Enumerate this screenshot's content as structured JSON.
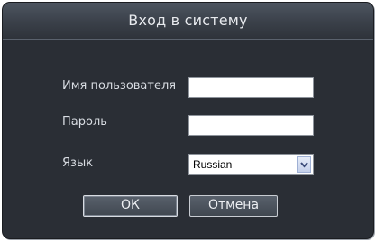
{
  "dialog": {
    "title": "Вход в систему"
  },
  "form": {
    "username_label": "Имя пользователя",
    "username_value": "",
    "password_label": "Пароль",
    "password_value": "",
    "language_label": "Язык",
    "language_selected": "Russian"
  },
  "buttons": {
    "ok_label": "ОК",
    "cancel_label": "Отмена"
  },
  "icons": {
    "dropdown": "chevron-down-icon"
  },
  "colors": {
    "background": "#2a2e35",
    "title_bar": "#3a4049",
    "text": "#d9dde3"
  }
}
